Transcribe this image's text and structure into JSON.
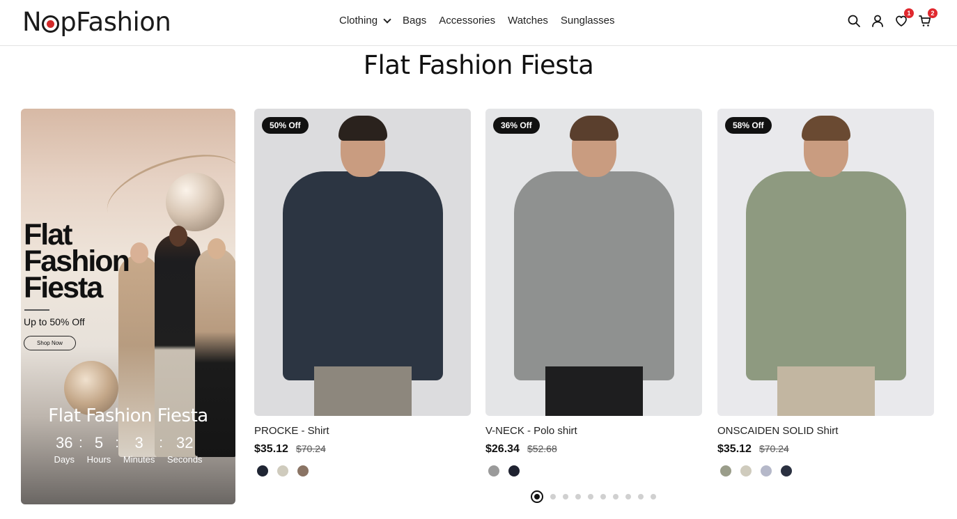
{
  "header": {
    "logo": {
      "before": "N",
      "after": "pFashion"
    },
    "nav": [
      {
        "label": "Clothing",
        "has_dropdown": true
      },
      {
        "label": "Bags"
      },
      {
        "label": "Accessories"
      },
      {
        "label": "Watches"
      },
      {
        "label": "Sunglasses"
      }
    ],
    "icons": [
      {
        "name": "search-icon"
      },
      {
        "name": "user-icon"
      },
      {
        "name": "wishlist-icon",
        "badge": "1"
      },
      {
        "name": "cart-icon",
        "badge": "2"
      }
    ]
  },
  "section": {
    "title": "Flat Fashion Fiesta"
  },
  "promo": {
    "headline": [
      "Flat",
      "Fashion",
      "Fiesta"
    ],
    "subtitle": "Up to 50% Off",
    "button": "Shop Now",
    "title": "Flat Fashion Fiesta",
    "countdown": [
      {
        "value": "36",
        "label": "Days"
      },
      {
        "value": "5",
        "label": "Hours"
      },
      {
        "value": "3",
        "label": "Minutes"
      },
      {
        "value": "32",
        "label": "Seconds"
      }
    ]
  },
  "products": [
    {
      "badge": "50% Off",
      "name": "PROCKE - Shirt",
      "price": "$35.12",
      "old_price": "$70.24",
      "swatches": [
        "#1f2533",
        "#cfcbbd",
        "#8a7464"
      ],
      "colors": {
        "bg": "#dcdcde",
        "shirt": "#2c3542",
        "hair": "#2a221d",
        "legs": "#8d877d"
      }
    },
    {
      "badge": "36% Off",
      "name": "V-NECK - Polo shirt",
      "price": "$26.34",
      "old_price": "$52.68",
      "swatches": [
        "#9a9a9a",
        "#1f2230"
      ],
      "colors": {
        "bg": "#e4e5e7",
        "shirt": "#8f9190",
        "hair": "#5a3f2d",
        "legs": "#1e1e1f"
      }
    },
    {
      "badge": "58% Off",
      "name": "ONSCAIDEN SOLID Shirt",
      "price": "$35.12",
      "old_price": "$70.24",
      "swatches": [
        "#9a9d8a",
        "#cfcbbd",
        "#b5b8c9",
        "#2a3040"
      ],
      "colors": {
        "bg": "#e9e9ec",
        "shirt": "#8e9a80",
        "hair": "#6a4a32",
        "legs": "#c2b6a1"
      }
    }
  ],
  "pagination": {
    "total": 10,
    "active": 0
  }
}
